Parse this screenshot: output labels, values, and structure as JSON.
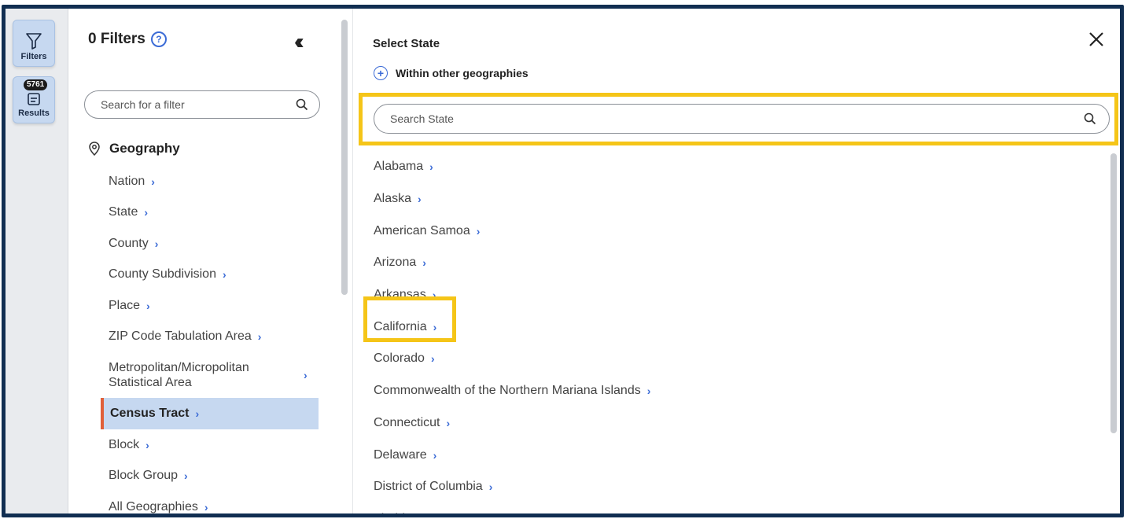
{
  "rail": {
    "filters_label": "Filters",
    "results_label": "Results",
    "results_count": "5761"
  },
  "filters_panel": {
    "title": "0 Filters",
    "search_placeholder": "Search for a filter",
    "section_title": "Geography",
    "items": [
      {
        "label": "Nation"
      },
      {
        "label": "State"
      },
      {
        "label": "County"
      },
      {
        "label": "County Subdivision"
      },
      {
        "label": "Place"
      },
      {
        "label": "ZIP Code Tabulation Area"
      },
      {
        "label": "Metropolitan/Micropolitan Statistical Area"
      },
      {
        "label": "Census Tract"
      },
      {
        "label": "Block"
      },
      {
        "label": "Block Group"
      },
      {
        "label": "All Geographies"
      }
    ]
  },
  "state_panel": {
    "title": "Select State",
    "within_label": "Within other geographies",
    "search_placeholder": "Search State",
    "states": [
      "Alabama",
      "Alaska",
      "American Samoa",
      "Arizona",
      "Arkansas",
      "California",
      "Colorado",
      "Commonwealth of the Northern Mariana Islands",
      "Connecticut",
      "Delaware",
      "District of Columbia",
      "Florida"
    ]
  }
}
